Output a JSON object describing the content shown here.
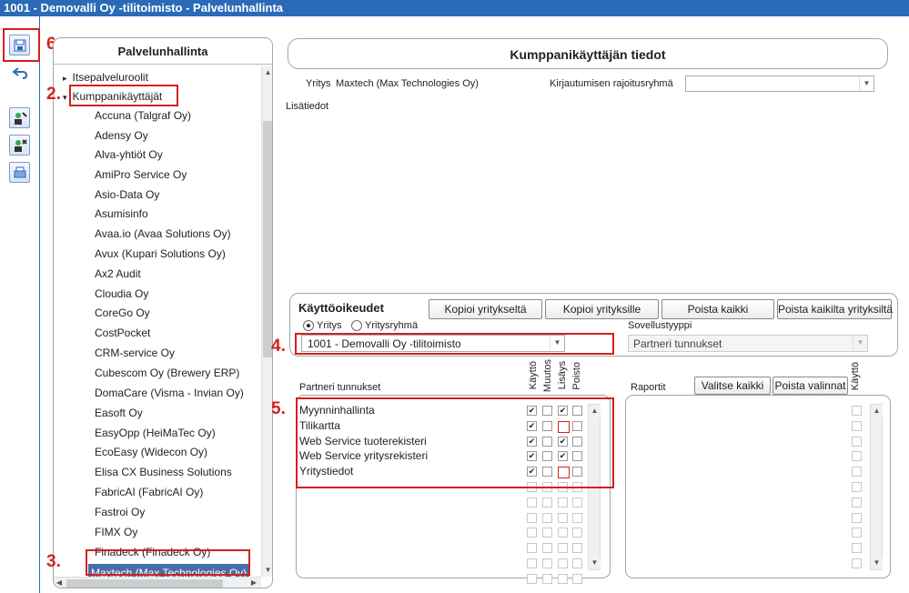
{
  "window": {
    "title": "1001 - Demovalli Oy -tilitoimisto - Palvelunhallinta"
  },
  "annotations": {
    "n2": "2.",
    "n3": "3.",
    "n4": "4.",
    "n5": "5.",
    "n6": "6."
  },
  "toolbar": {
    "icons": [
      "save-icon",
      "undo-icon",
      "user-add-icon",
      "user-remove-icon",
      "print-icon"
    ]
  },
  "tree": {
    "header": "Palvelunhallinta",
    "items": [
      {
        "label": "Itsepalveluroolit",
        "level": 0,
        "expander": "▸"
      },
      {
        "label": "Kumppanikäyttäjät",
        "level": 0,
        "expander": "▾"
      },
      {
        "label": "Accuna (Talgraf Oy)",
        "level": 1
      },
      {
        "label": "Adensy Oy",
        "level": 1
      },
      {
        "label": "Alva-yhtiöt Oy",
        "level": 1
      },
      {
        "label": "AmiPro Service Oy",
        "level": 1
      },
      {
        "label": "Asio-Data Oy",
        "level": 1
      },
      {
        "label": "Asumisinfo",
        "level": 1
      },
      {
        "label": "Avaa.io (Avaa Solutions Oy)",
        "level": 1
      },
      {
        "label": "Avux (Kupari Solutions Oy)",
        "level": 1
      },
      {
        "label": "Ax2 Audit",
        "level": 1
      },
      {
        "label": "Cloudia Oy",
        "level": 1
      },
      {
        "label": "CoreGo Oy",
        "level": 1
      },
      {
        "label": "CostPocket",
        "level": 1
      },
      {
        "label": "CRM-service Oy",
        "level": 1
      },
      {
        "label": "Cubescom Oy (Brewery ERP)",
        "level": 1
      },
      {
        "label": "DomaCare (Visma - Invian Oy)",
        "level": 1
      },
      {
        "label": "Easoft Oy",
        "level": 1
      },
      {
        "label": "EasyOpp (HeiMaTec Oy)",
        "level": 1
      },
      {
        "label": "EcoEasy (Widecon Oy)",
        "level": 1
      },
      {
        "label": "Elisa CX Business Solutions",
        "level": 1
      },
      {
        "label": "FabricAI (FabricAI Oy)",
        "level": 1
      },
      {
        "label": "Fastroi Oy",
        "level": 1
      },
      {
        "label": "FIMX Oy",
        "level": 1
      },
      {
        "label": "Finadeck (Finadeck Oy)",
        "level": 1
      },
      {
        "label": "Maxtech (Max Technologies Oy)",
        "level": 1,
        "selected": true
      }
    ]
  },
  "details": {
    "title": "Kumppanikäyttäjän tiedot",
    "company_label": "Yritys",
    "company_value": "Maxtech (Max Technologies Oy)",
    "login_group_label": "Kirjautumisen rajoitusryhmä",
    "login_group_value": "",
    "extra_label": "Lisätiedot"
  },
  "permissions": {
    "title": "Käyttöoikeudet",
    "buttons": [
      "Kopioi yritykseltä",
      "Kopioi yrityksille",
      "Poista kaikki",
      "Poista kaikilta yrityksiltä"
    ],
    "radio_company": "Yritys",
    "radio_group": "Yritysryhmä",
    "company_select": "1001 - Demovalli Oy -tilitoimisto",
    "apptype_label": "Sovellustyyppi",
    "apptype_value": "Partneri tunnukset"
  },
  "partner": {
    "title": "Partneri tunnukset",
    "columns": [
      "Käyttö",
      "Muutos",
      "Lisäys",
      "Poisto"
    ],
    "rows": [
      {
        "name": "Myynninhallinta",
        "checks": [
          true,
          false,
          true,
          false
        ]
      },
      {
        "name": "Tilikartta",
        "checks": [
          true,
          false,
          false,
          false
        ]
      },
      {
        "name": "Web Service tuoterekisteri",
        "checks": [
          true,
          false,
          true,
          false
        ]
      },
      {
        "name": "Web Service yritysrekisteri",
        "checks": [
          true,
          false,
          true,
          false
        ]
      },
      {
        "name": "Yritystiedot",
        "checks": [
          true,
          false,
          false,
          false
        ]
      }
    ]
  },
  "reports": {
    "title": "Raportit",
    "select_all": "Valitse kaikki",
    "clear": "Poista valinnat",
    "column": "Käyttö"
  }
}
